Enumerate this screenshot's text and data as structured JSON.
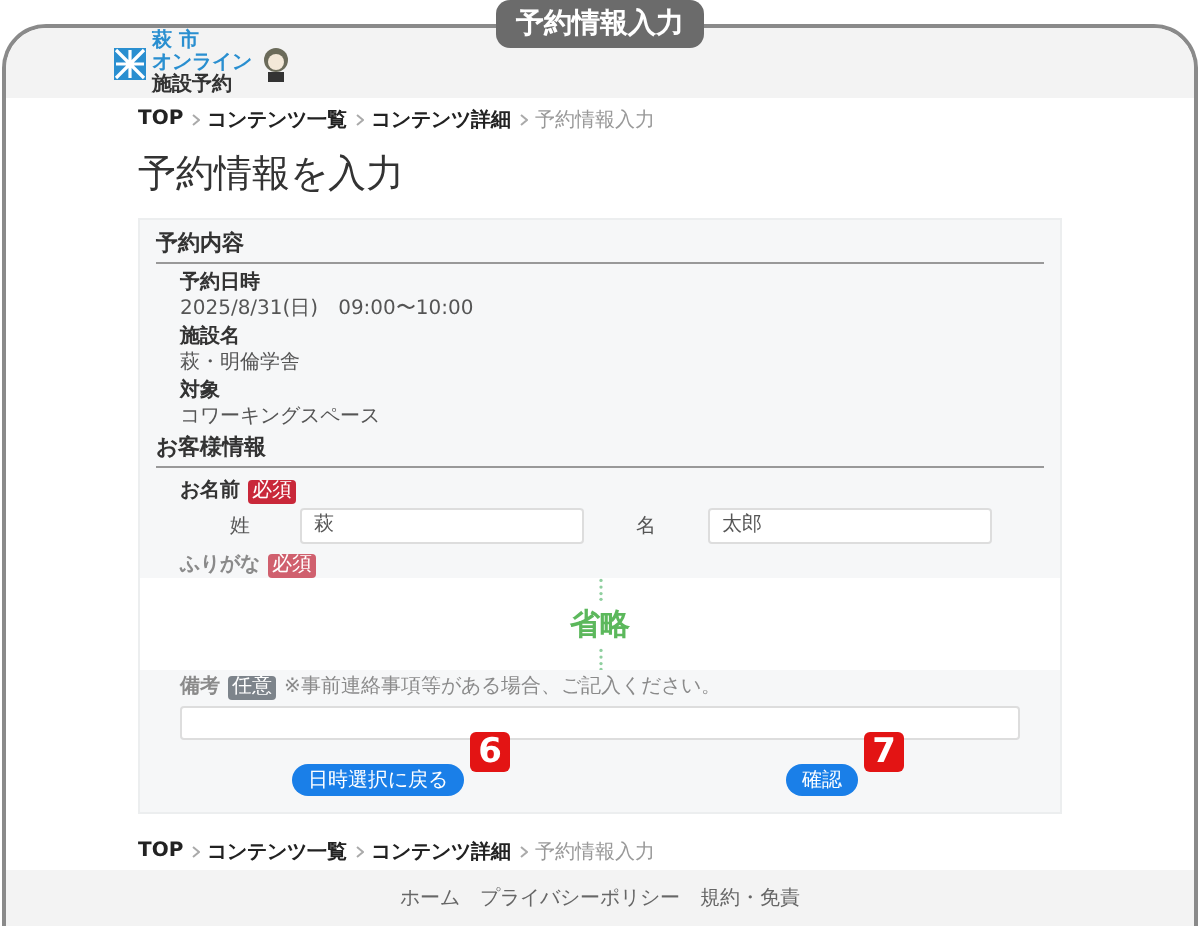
{
  "frame_label": "予約情報入力",
  "header": {
    "logo": {
      "line_1": "萩 市",
      "line_2": "オンライン",
      "line_3": "施設予約"
    }
  },
  "breadcrumb": [
    {
      "label": "TOP",
      "current": false
    },
    {
      "label": "コンテンツ一覧",
      "current": false
    },
    {
      "label": "コンテンツ詳細",
      "current": false
    },
    {
      "label": "予約情報入力",
      "current": true
    }
  ],
  "page_title": "予約情報を入力",
  "reservation": {
    "heading": "予約内容",
    "fields": [
      {
        "label": "予約日時",
        "value": "2025/8/31(日)　09:00〜10:00"
      },
      {
        "label": "施設名",
        "value": "萩・明倫学舎"
      },
      {
        "label": "対象",
        "value": "コワーキングスペース"
      }
    ]
  },
  "customer": {
    "heading": "お客様情報",
    "name_label": "お名前",
    "name_badge": "必須",
    "last_name": {
      "label": "姓",
      "value": "萩"
    },
    "first_name": {
      "label": "名",
      "value": "太郎"
    },
    "furigana_label": "ふりがな",
    "furigana_badge": "必須"
  },
  "omission": "省略",
  "notes": {
    "label": "備考",
    "badge": "任意",
    "hint": "※事前連絡事項等がある場合、ご記入ください。"
  },
  "buttons": [
    {
      "label": "日時選択に戻る",
      "marker": "6"
    },
    {
      "label": "確認",
      "marker": "7"
    }
  ],
  "footer_breadcrumb": [
    {
      "label": "TOP",
      "current": false
    },
    {
      "label": "コンテンツ一覧",
      "current": false
    },
    {
      "label": "コンテンツ詳細",
      "current": false
    },
    {
      "label": "予約情報入力",
      "current": true
    }
  ],
  "footer_links": [
    "ホーム",
    "プライバシーポリシー",
    "規約・免責"
  ]
}
